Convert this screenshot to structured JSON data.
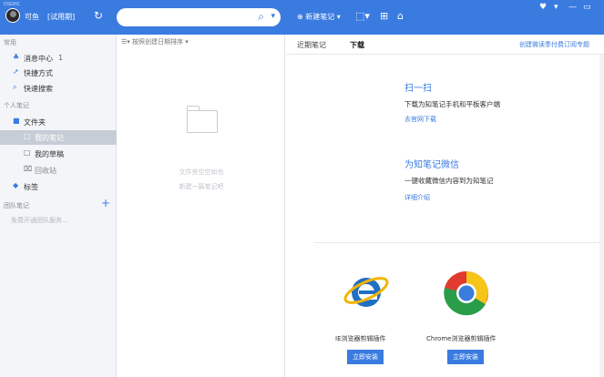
{
  "top": {
    "avatar_caption": "DSGHC",
    "username": "可鱼",
    "trial": "[试用期]",
    "new_note": "新建笔记"
  },
  "sidebar": {
    "sections": {
      "common": "常用",
      "personal": "个人笔记",
      "team": "团队笔记"
    },
    "items": [
      {
        "label": "消息中心",
        "badge": "1"
      },
      {
        "label": "快捷方式"
      },
      {
        "label": "快速搜索"
      },
      {
        "label": "文件夹"
      },
      {
        "label": "我的笔记"
      },
      {
        "label": "我的草稿"
      },
      {
        "label": "回收站"
      },
      {
        "label": "标签"
      }
    ],
    "team_hint": "免费开通团队服务..."
  },
  "list": {
    "sort": "按照创建日期排序",
    "empty1": "文件夹空空如也",
    "empty2": "新建一篇笔记吧"
  },
  "main": {
    "tab_recent": "近期笔记",
    "tab_download": "下载",
    "tab_link": "创建微读季付费订阅专题",
    "scan_title": "扫一扫",
    "scan_desc": "下载为知笔记手机和平板客户端",
    "scan_link": "去官网下载",
    "wechat_title": "为知笔记微信",
    "wechat_desc": "一键收藏微信内容到为知笔记",
    "wechat_link": "详细介绍",
    "ie_label": "IE浏览器剪辑插件",
    "chrome_label": "Chrome浏览器剪辑插件",
    "install": "立即安装"
  }
}
